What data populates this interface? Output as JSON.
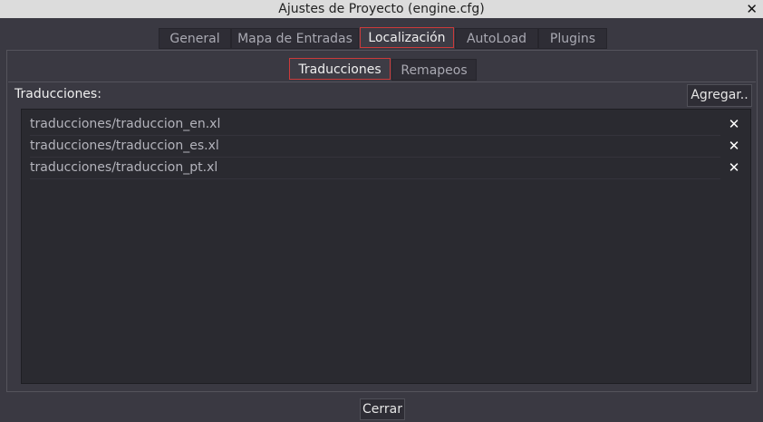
{
  "window": {
    "title": "Ajustes de Proyecto (engine.cfg)",
    "close_glyph": "✕",
    "close_icon": "close-icon"
  },
  "tabs": [
    {
      "label": "General",
      "active": false
    },
    {
      "label": "Mapa de Entradas",
      "active": false
    },
    {
      "label": "Localización",
      "active": true
    },
    {
      "label": "AutoLoad",
      "active": false
    },
    {
      "label": "Plugins",
      "active": false
    }
  ],
  "subtabs": [
    {
      "label": "Traducciones",
      "active": true
    },
    {
      "label": "Remapeos",
      "active": false
    }
  ],
  "translations": {
    "label": "Traducciones:",
    "add_label": "Agregar..",
    "items": [
      "traducciones/traduccion_en.xl",
      "traducciones/traduccion_es.xl",
      "traducciones/traduccion_pt.xl"
    ],
    "remove_glyph": "✕",
    "remove_icon": "remove-icon"
  },
  "footer": {
    "close_label": "Cerrar"
  },
  "colors": {
    "active_tab_border": "#cc3a3a",
    "background": "#3a3942",
    "list_background": "#2a2a30"
  }
}
